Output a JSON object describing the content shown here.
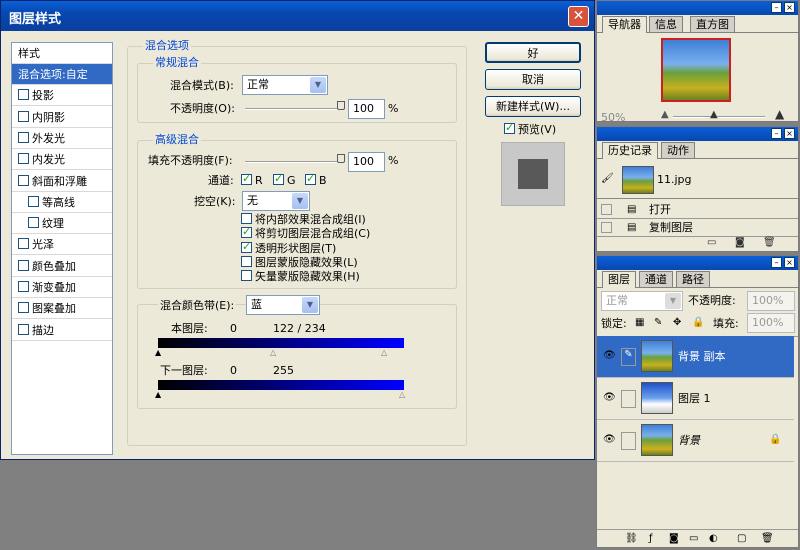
{
  "dialog": {
    "title": "图层样式",
    "close": "✕",
    "style_header": "样式",
    "styles": [
      {
        "label": "混合选项:自定",
        "selected": true,
        "checkbox": false
      },
      {
        "label": "投影",
        "checkbox": true
      },
      {
        "label": "内阴影",
        "checkbox": true
      },
      {
        "label": "外发光",
        "checkbox": true
      },
      {
        "label": "内发光",
        "checkbox": true
      },
      {
        "label": "斜面和浮雕",
        "checkbox": true
      },
      {
        "label": "等高线",
        "checkbox": true,
        "indent": true
      },
      {
        "label": "纹理",
        "checkbox": true,
        "indent": true
      },
      {
        "label": "光泽",
        "checkbox": true
      },
      {
        "label": "颜色叠加",
        "checkbox": true
      },
      {
        "label": "渐变叠加",
        "checkbox": true
      },
      {
        "label": "图案叠加",
        "checkbox": true
      },
      {
        "label": "描边",
        "checkbox": true
      }
    ],
    "blend_options_title": "混合选项",
    "general_title": "常规混合",
    "blend_mode_label": "混合模式(B):",
    "blend_mode_value": "正常",
    "opacity_label": "不透明度(O):",
    "opacity_value": "100",
    "percent": "%",
    "advanced_title": "高级混合",
    "fill_opacity_label": "填充不透明度(F):",
    "fill_opacity_value": "100",
    "channels_label": "通道:",
    "channel_r": "R",
    "channel_g": "G",
    "channel_b": "B",
    "knockout_label": "挖空(K):",
    "knockout_value": "无",
    "options": [
      {
        "label": "将内部效果混合成组(I)",
        "checked": false
      },
      {
        "label": "将剪切图层混合成组(C)",
        "checked": true
      },
      {
        "label": "透明形状图层(T)",
        "checked": true
      },
      {
        "label": "图层蒙版隐藏效果(L)",
        "checked": false
      },
      {
        "label": "矢量蒙版隐藏效果(H)",
        "checked": false
      }
    ],
    "blend_if_label": "混合颜色带(E):",
    "blend_if_value": "蓝",
    "this_layer_label": "本图层:",
    "this_layer_min": "0",
    "this_layer_max": "122 / 234",
    "under_layer_label": "下一图层:",
    "under_layer_min": "0",
    "under_layer_max": "255",
    "ok": "好",
    "cancel": "取消",
    "new_style": "新建样式(W)...",
    "preview_label": "预览(V)",
    "preview_checked": true,
    "colors": {
      "accent": "#316ac5",
      "bar_blue": "#0000ff",
      "preview_square": "#595959"
    }
  },
  "navigator": {
    "tabs": [
      "导航器",
      "信息",
      "直方图"
    ],
    "zoom": "50%"
  },
  "history": {
    "tabs": [
      "历史记录",
      "动作"
    ],
    "snapshot": "11.jpg",
    "steps": [
      "打开",
      "复制图层"
    ]
  },
  "layers": {
    "tabs": [
      "图层",
      "通道",
      "路径"
    ],
    "mode": "正常",
    "opacity_label": "不透明度:",
    "opacity_value": "100%",
    "lock_label": "锁定:",
    "fill_label": "填充:",
    "fill_value": "100%",
    "items": [
      {
        "name": "背景 副本",
        "selected": true
      },
      {
        "name": "图层 1",
        "selected": false
      },
      {
        "name": "背景",
        "selected": false,
        "locked": true
      }
    ]
  }
}
